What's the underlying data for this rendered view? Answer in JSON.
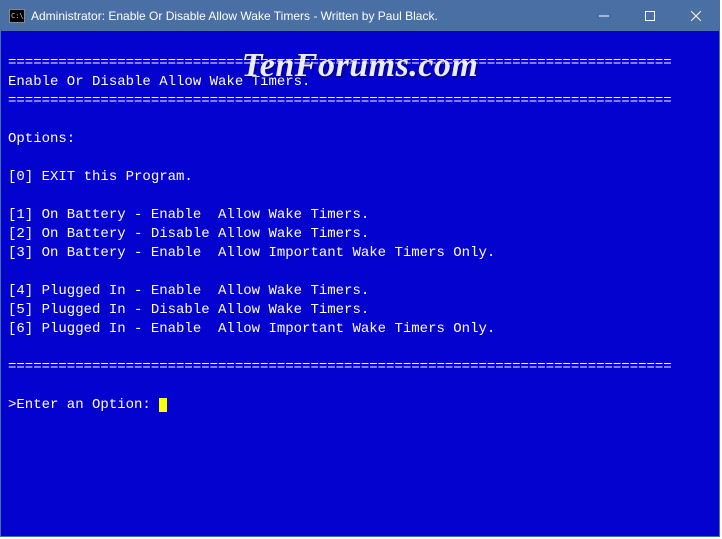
{
  "titlebar": {
    "text": "Administrator:  Enable Or Disable Allow Wake Timers - Written by Paul Black."
  },
  "watermark": "TenForums.com",
  "console": {
    "blank0": "",
    "divider": "===============================================================================",
    "header": "Enable Or Disable Allow Wake Timers.",
    "blank1": "",
    "optionsLabel": "Options:",
    "blank2": "",
    "opt0": "[0] EXIT this Program.",
    "blank3": "",
    "opt1": "[1] On Battery - Enable  Allow Wake Timers.",
    "opt2": "[2] On Battery - Disable Allow Wake Timers.",
    "opt3": "[3] On Battery - Enable  Allow Important Wake Timers Only.",
    "blank4": "",
    "opt4": "[4] Plugged In - Enable  Allow Wake Timers.",
    "opt5": "[5] Plugged In - Disable Allow Wake Timers.",
    "opt6": "[6] Plugged In - Enable  Allow Important Wake Timers Only.",
    "blank5": "",
    "blank6": "",
    "prompt": ">Enter an Option: "
  }
}
